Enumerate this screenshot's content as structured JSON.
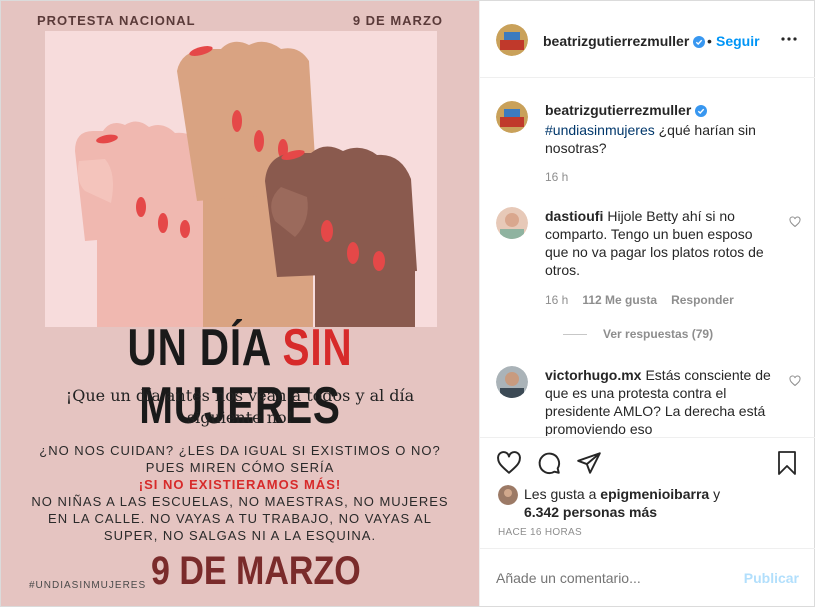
{
  "poster": {
    "top_left": "PROTESTA NACIONAL",
    "top_right": "9 DE MARZO",
    "headline_pre": "UN DÍA ",
    "headline_red": "SIN",
    "headline_post": " MUJERES",
    "subtitle": "¡Que un día antes nos vean a todos y al día siguiente no!",
    "body_line1": "¿NO NOS CUIDAN? ¿LES DA IGUAL SI EXISTIMOS O NO? PUES MIREN CÓMO SERÍA",
    "body_red": "¡SI NO EXISTIERAMOS MÁS!",
    "body_line2": "NO NIÑAS A LAS ESCUELAS, NO MAESTRAS, NO MUJERES EN LA CALLE. NO VAYAS A TU TRABAJO, NO VAYAS AL SUPER, NO SALGAS NI A LA ESQUINA.",
    "hashtag": "#UNDIASINMUJERES",
    "date": "9 DE MARZO"
  },
  "header": {
    "username": "beatrizgutierrezmuller",
    "separator": "•",
    "follow_label": "Seguir",
    "more_icon": "more-horizontal-icon"
  },
  "caption": {
    "username": "beatrizgutierrezmuller",
    "hashtag": "#undiasinmujeres",
    "text": " ¿qué harían sin nosotras?",
    "time": "16 h"
  },
  "comments": [
    {
      "username": "dastioufi",
      "text": "Hijole Betty ahí si no comparto. Tengo un buen esposo que no va pagar los platos rotos de otros.",
      "time": "16 h",
      "likes": "112 Me gusta",
      "reply_label": "Responder",
      "view_replies": "Ver respuestas (79)"
    },
    {
      "username": "victorhugo.mx",
      "text": "Estás consciente de que es una protesta contra el presidente AMLO? La derecha está promoviendo eso"
    }
  ],
  "likes": {
    "prefix": "Les gusta a ",
    "user": "epigmenioibarra",
    "middle": " y",
    "others": "6.342 personas más"
  },
  "timestamp": "HACE 16 HORAS",
  "add_comment": {
    "placeholder": "Añade un comentario...",
    "publish_label": "Publicar"
  },
  "colors": {
    "link_blue": "#0095f6",
    "hashtag_blue": "#00376b",
    "poster_red": "#d72a2a",
    "poster_bg": "#e5c4c1"
  }
}
